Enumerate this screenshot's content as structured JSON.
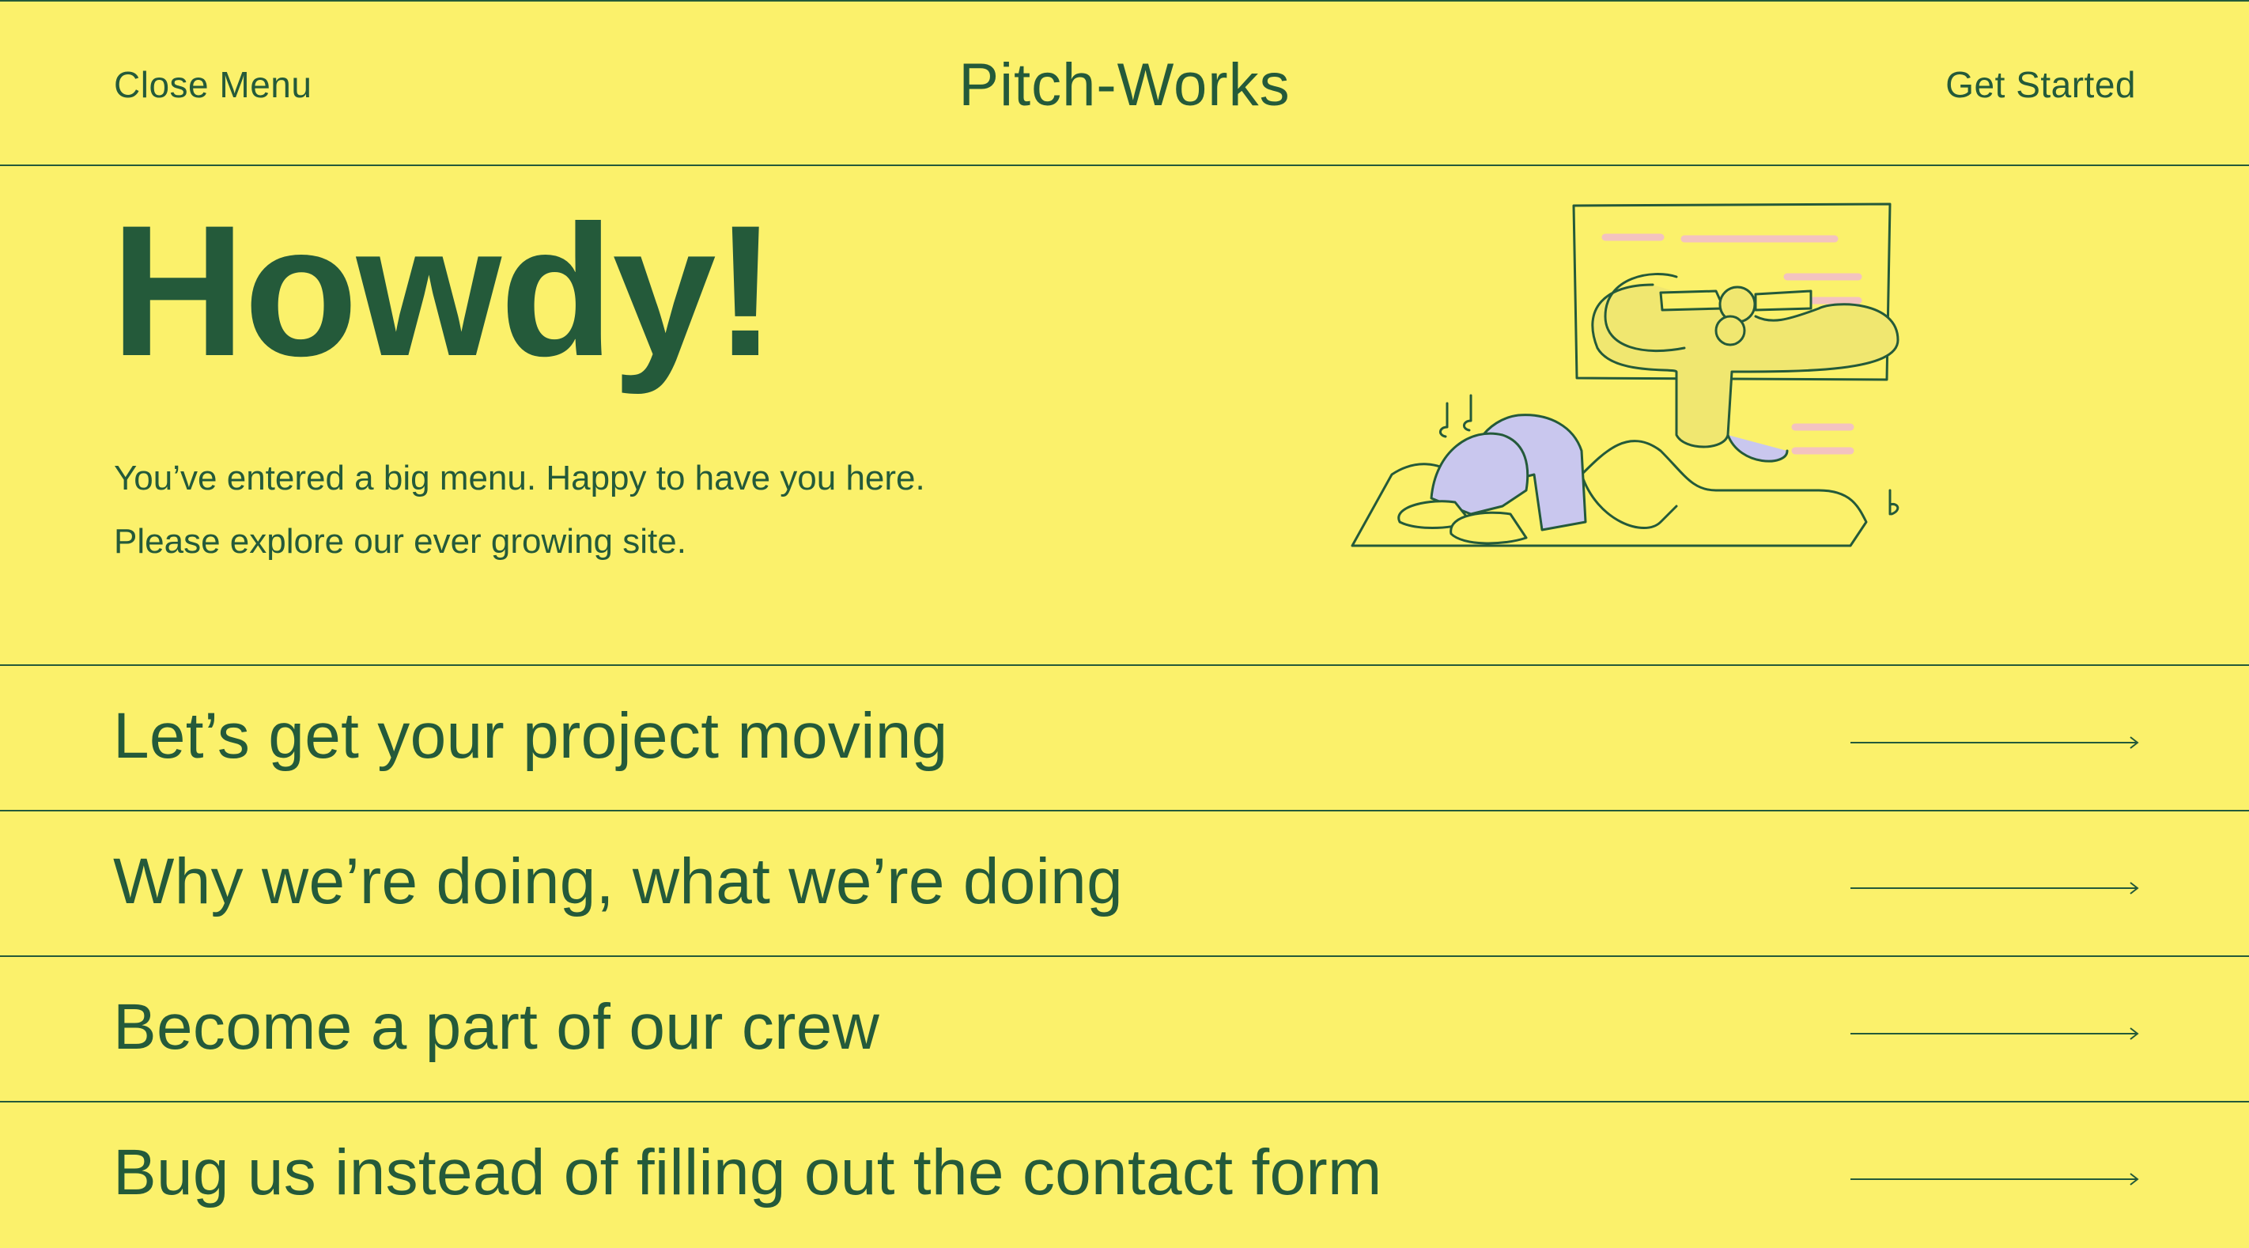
{
  "header": {
    "close_menu_label": "Close Menu",
    "brand": "Pitch-Works",
    "get_started_label": "Get Started"
  },
  "hero": {
    "headline": "Howdy!",
    "intro": "You’ve entered a big menu. Happy to have you here. Please explore our ever growing site.",
    "illustration_icon": "person-relaxing-on-scroll-illustration"
  },
  "menu": {
    "items": [
      {
        "label": "Let’s get your project moving",
        "icon": "arrow-right-icon"
      },
      {
        "label": "Why we’re doing, what we’re doing",
        "icon": "arrow-right-icon"
      },
      {
        "label": "Become a part of our crew",
        "icon": "arrow-right-icon"
      },
      {
        "label": "Bug us instead of filling out the contact form",
        "icon": "arrow-right-icon"
      }
    ]
  },
  "colors": {
    "background": "#fbf16b",
    "ink": "#245a3a",
    "accent_lavender": "#c9c7ee",
    "accent_pink": "#f3c3c0"
  }
}
